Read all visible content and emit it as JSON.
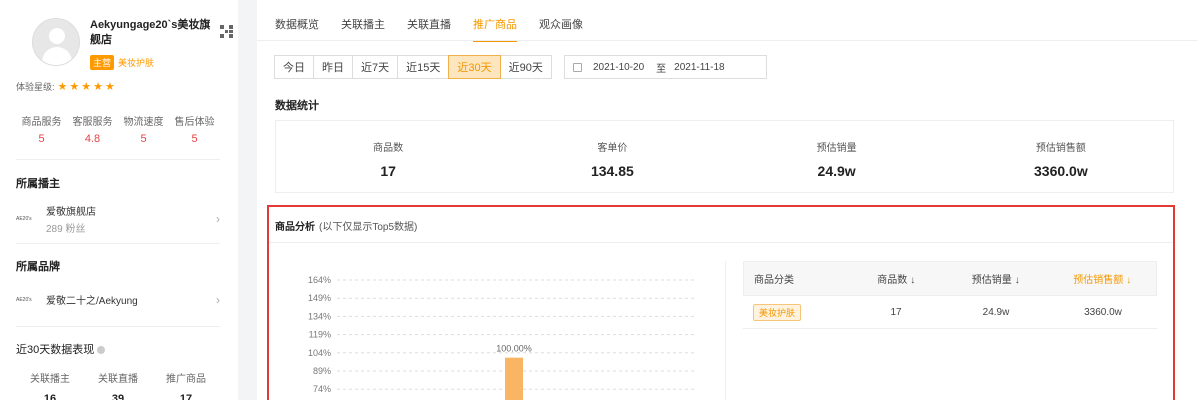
{
  "shop": {
    "name": "Aekyungage20`s美妆旗舰店",
    "tag_main": "主营",
    "tag_category": "美妆护肤",
    "rating_label": "体验星级:",
    "stars": "★★★★★"
  },
  "service": [
    {
      "label": "商品服务",
      "value": "5"
    },
    {
      "label": "客服服务",
      "value": "4.8"
    },
    {
      "label": "物流速度",
      "value": "5"
    },
    {
      "label": "售后体验",
      "value": "5"
    }
  ],
  "anchor_section": {
    "title": "所属播主",
    "logo_text": "AE20's",
    "name": "爱敬旗舰店",
    "fans": "289 粉丝"
  },
  "brand_section": {
    "title": "所属品牌",
    "logo_text": "AE20's",
    "name": "爱敬二十之/Aekyung"
  },
  "performance": {
    "title": "近30天数据表现",
    "items": [
      {
        "label": "关联播主",
        "value": "16"
      },
      {
        "label": "关联直播",
        "value": "39"
      },
      {
        "label": "推广商品",
        "value": "17"
      }
    ]
  },
  "tabs": [
    {
      "label": "数据概览",
      "active": false
    },
    {
      "label": "关联播主",
      "active": false
    },
    {
      "label": "关联直播",
      "active": false
    },
    {
      "label": "推广商品",
      "active": true
    },
    {
      "label": "观众画像",
      "active": false
    }
  ],
  "date_buttons": [
    {
      "label": "今日",
      "active": false
    },
    {
      "label": "昨日",
      "active": false
    },
    {
      "label": "近7天",
      "active": false
    },
    {
      "label": "近15天",
      "active": false
    },
    {
      "label": "近30天",
      "active": true
    },
    {
      "label": "近90天",
      "active": false
    }
  ],
  "date_range": {
    "start": "2021-10-20",
    "to": "至",
    "end": "2021-11-18"
  },
  "stats": {
    "title": "数据统计",
    "items": [
      {
        "label": "商品数",
        "value": "17"
      },
      {
        "label": "客单价",
        "value": "134.85"
      },
      {
        "label": "预估销量",
        "value": "24.9w"
      },
      {
        "label": "预估销售额",
        "value": "3360.0w"
      }
    ]
  },
  "analysis": {
    "title": "商品分析",
    "subtitle": "(以下仅显示Top5数据)"
  },
  "chart_data": {
    "type": "bar",
    "categories": [
      "美妆护肤"
    ],
    "values": [
      100
    ],
    "data_labels": [
      "100.00%"
    ],
    "y_ticks": [
      "164%",
      "149%",
      "134%",
      "119%",
      "104%",
      "89%",
      "74%"
    ],
    "ylim": [
      0,
      164
    ],
    "grid": true,
    "bar_color": "#f9b563"
  },
  "table": {
    "headers": {
      "category": "商品分类",
      "count": "商品数",
      "sales": "预估销量",
      "revenue": "预估销售额"
    },
    "sort_glyph": "↓",
    "rows": [
      {
        "category": "美妆护肤",
        "count": "17",
        "sales": "24.9w",
        "revenue": "3360.0w"
      }
    ]
  }
}
